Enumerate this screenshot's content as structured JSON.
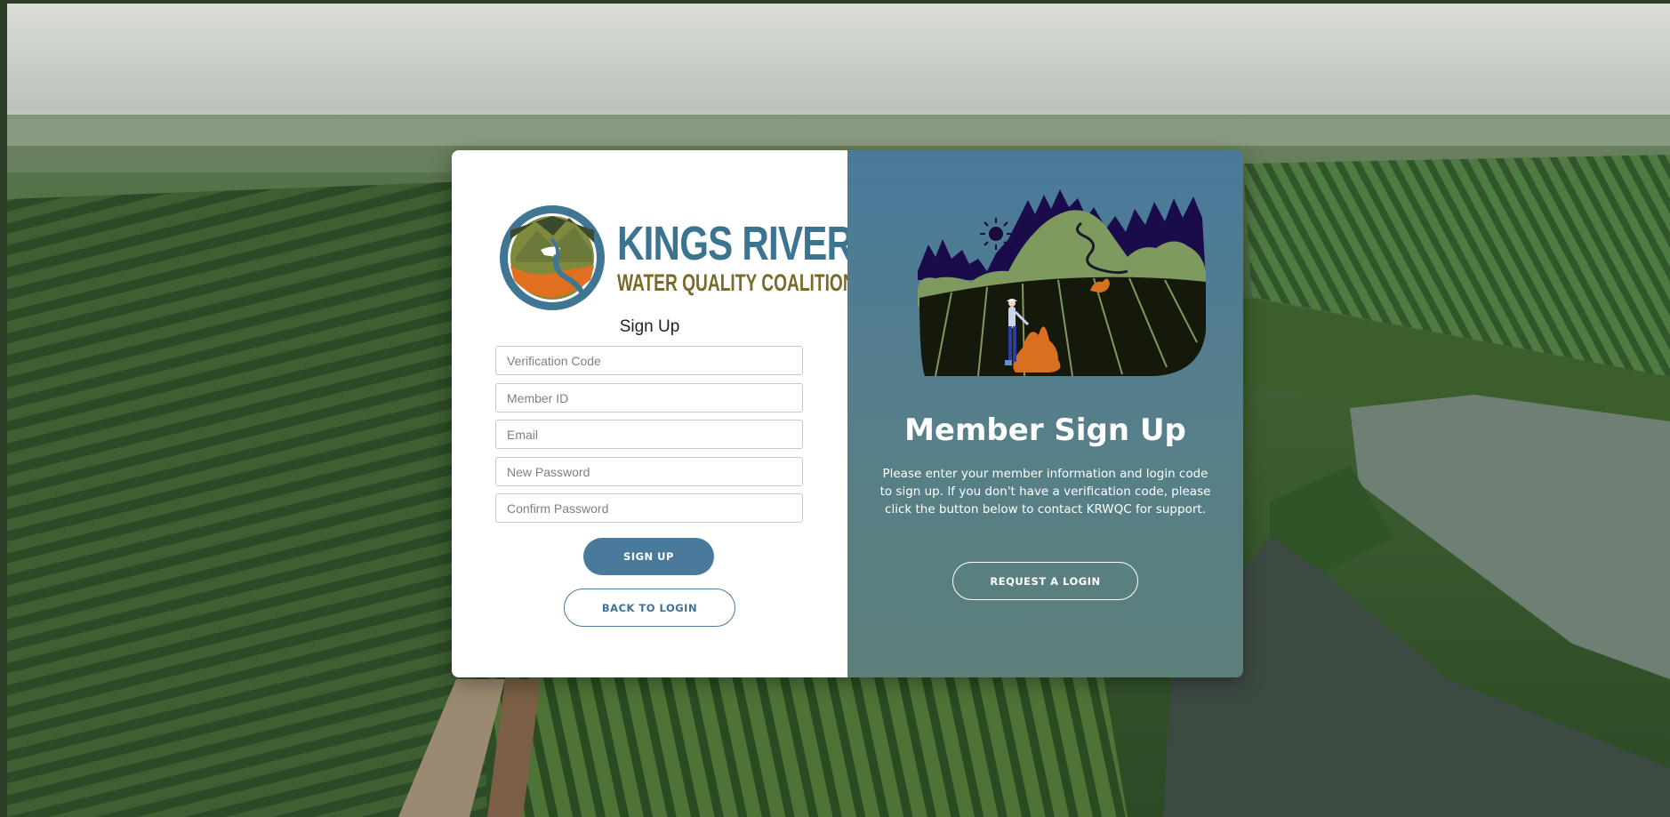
{
  "logo": {
    "title": "KINGS RIVER",
    "subtitle": "WATER QUALITY COALITION"
  },
  "form": {
    "title": "Sign Up",
    "fields": {
      "verification_code": {
        "placeholder": "Verification Code",
        "value": ""
      },
      "member_id": {
        "placeholder": "Member ID",
        "value": ""
      },
      "email": {
        "placeholder": "Email",
        "value": ""
      },
      "new_password": {
        "placeholder": "New Password",
        "value": ""
      },
      "confirm_password": {
        "placeholder": "Confirm Password",
        "value": ""
      }
    },
    "signup_label": "SIGN UP",
    "back_label": "BACK TO LOGIN"
  },
  "panel": {
    "title": "Member Sign Up",
    "description": "Please enter your member information and login code to sign up. If you don't have a verification code, please click the button below to contact KRWQC for support.",
    "request_label": "REQUEST A LOGIN"
  },
  "colors": {
    "accent": "#4a7a9b",
    "panel_bottom": "#5d7f7a",
    "logo_blue": "#3a7490",
    "logo_olive": "#7a6a2a",
    "illustration_orange": "#d9701f"
  },
  "icons": [
    "kings-river-logo-icon",
    "farm-landscape-illustration"
  ]
}
